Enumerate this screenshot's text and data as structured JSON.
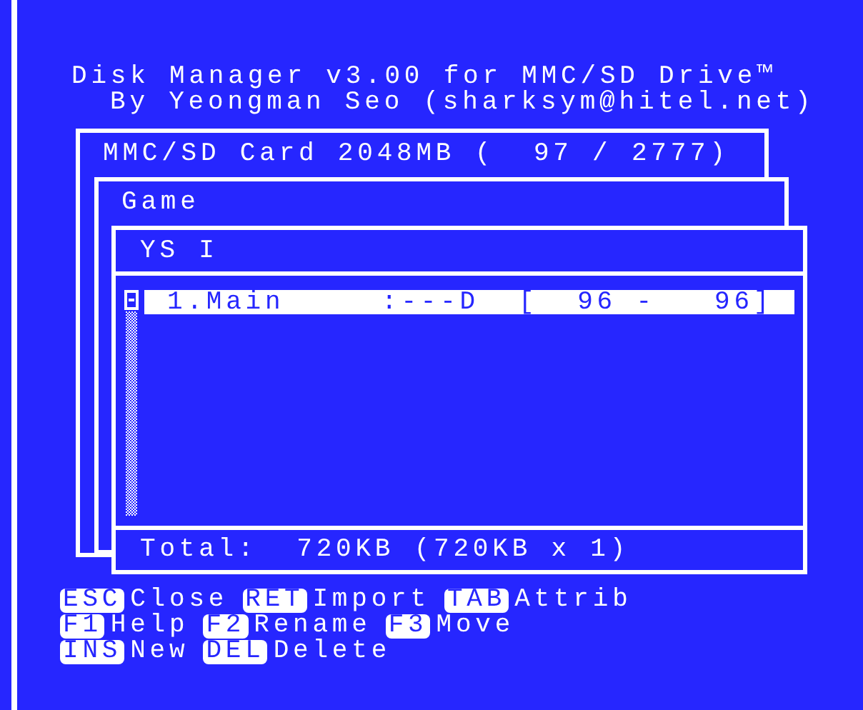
{
  "header": {
    "title": "Disk Manager v3.00 for MMC/SD Drive™",
    "author": "By Yeongman Seo (sharksym@hitel.net)"
  },
  "windows": [
    {
      "title": "MMC/SD Card 2048MB (  97 / 2777)"
    },
    {
      "title": "Game"
    },
    {
      "title": "YS I"
    }
  ],
  "files": [
    {
      "name": "1.Main",
      "attributes": ":---D",
      "range": "[  96 -   96]",
      "selected": true
    }
  ],
  "total": "Total:  720KB (720KB x 1)",
  "keys": [
    [
      {
        "key": "ESC",
        "action": "Close"
      },
      {
        "key": "RET",
        "action": "Import"
      },
      {
        "key": "TAB",
        "action": "Attrib"
      }
    ],
    [
      {
        "key": "F1",
        "action": "Help"
      },
      {
        "key": "F2",
        "action": "Rename"
      },
      {
        "key": "F3",
        "action": "Move"
      }
    ],
    [
      {
        "key": "INS",
        "action": "New"
      },
      {
        "key": "DEL",
        "action": "Delete"
      }
    ]
  ]
}
